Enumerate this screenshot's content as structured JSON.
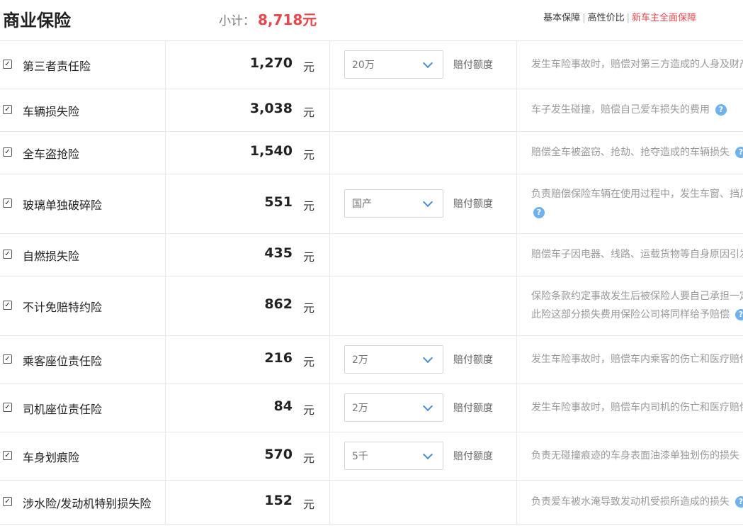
{
  "header": {
    "title": "商业保险",
    "subtotal_label": "小计：",
    "subtotal_value": "8,718元",
    "plans": [
      "基本保障",
      "高性价比",
      "新车主全面保障"
    ],
    "active_plan_index": 2
  },
  "colors": {
    "accent_red": "#e8464c",
    "help_blue": "#6fb0ee"
  },
  "unit": "元",
  "help_icon": "?",
  "checkbox_mark": "✓",
  "items": [
    {
      "name": "第三者责任险",
      "price": "1,270",
      "checked": true,
      "select": "20万",
      "select_label": "赔付额度",
      "desc": [
        "发生车险事故时，赔偿对第三方造成的人身及财产"
      ],
      "help": false
    },
    {
      "name": "车辆损失险",
      "price": "3,038",
      "checked": true,
      "desc": [
        "车子发生碰撞，赔偿自己爱车损失的费用"
      ],
      "help": true
    },
    {
      "name": "全车盗抢险",
      "price": "1,540",
      "checked": true,
      "desc": [
        "赔偿全车被盗窃、抢劫、抢夺造成的车辆损失"
      ],
      "help": true
    },
    {
      "name": "玻璃单独破碎险",
      "price": "551",
      "checked": true,
      "select": "国产",
      "select_label": "赔付额度",
      "desc": [
        "负责赔偿保险车辆在使用过程中，发生车窗、挡风",
        ""
      ],
      "help": true
    },
    {
      "name": "自燃损失险",
      "price": "435",
      "checked": true,
      "desc": [
        "赔偿车子因电器、线路、运载货物等自身原因引发"
      ],
      "help": false
    },
    {
      "name": "不计免赔特约险",
      "price": "862",
      "checked": true,
      "desc": [
        "保险条款约定事故发生后被保险人要自己承担一定",
        "此险这部分损失费用保险公司将同样给予赔偿"
      ],
      "help": true
    },
    {
      "name": "乘客座位责任险",
      "price": "216",
      "checked": true,
      "select": "2万",
      "select_label": "赔付额度",
      "desc": [
        "发生车险事故时，赔偿车内乘客的伤亡和医疗赔偿"
      ],
      "help": false
    },
    {
      "name": "司机座位责任险",
      "price": "84",
      "checked": true,
      "select": "2万",
      "select_label": "赔付额度",
      "desc": [
        "发生车险事故时，赔偿车内司机的伤亡和医疗赔偿"
      ],
      "help": false
    },
    {
      "name": "车身划痕险",
      "price": "570",
      "checked": true,
      "select": "5千",
      "select_label": "赔付额度",
      "desc": [
        "负责无碰撞痕迹的车身表面油漆单独划伤的损失"
      ],
      "help": false
    },
    {
      "name": "涉水险/发动机特别损失险",
      "price": "152",
      "checked": true,
      "desc": [
        "负责爱车被水淹导致发动机受损所造成的损失"
      ],
      "help": true
    }
  ]
}
